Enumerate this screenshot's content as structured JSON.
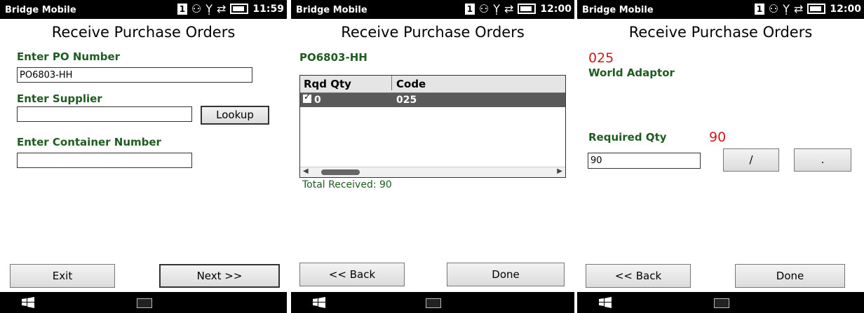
{
  "status": {
    "app_name": "Bridge Mobile",
    "badge": "1",
    "times": [
      "11:59",
      "12:00",
      "12:00"
    ]
  },
  "title": "Receive Purchase Orders",
  "screen1": {
    "po_label": "Enter PO Number",
    "po_value": "PO6803-HH",
    "supplier_label": "Enter Supplier",
    "supplier_value": "",
    "lookup_label": "Lookup",
    "container_label": "Enter Container Number",
    "container_value": "",
    "exit_label": "Exit",
    "next_label": "Next >>"
  },
  "screen2": {
    "po_number": "PO6803-HH",
    "columns": [
      "Rqd Qty",
      "Code"
    ],
    "rows": [
      {
        "qty": "0",
        "code": "025"
      }
    ],
    "total_received": "Total Received: 90",
    "back_label": "<< Back",
    "done_label": "Done"
  },
  "screen3": {
    "code": "025",
    "description": "World Adaptor",
    "required_qty_label": "Required Qty",
    "required_qty_value": "90",
    "qty_input": "90",
    "slash_label": "/",
    "dot_label": ".",
    "back_label": "<< Back",
    "done_label": "Done"
  },
  "icons": [
    "people-icon",
    "signal-icon",
    "sync-icon",
    "battery-icon",
    "windows-icon",
    "keyboard-icon"
  ],
  "colors": {
    "label_green": "#1e5c20",
    "accent_red": "#d01818",
    "status_bg": "#000000"
  }
}
